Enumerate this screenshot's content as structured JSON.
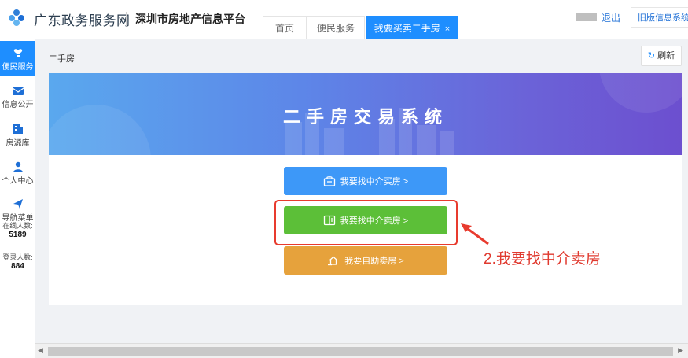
{
  "header": {
    "portal_name": "广东政务服务网",
    "platform_name": "深圳市房地产信息平台",
    "tabs": [
      {
        "label": "首页"
      },
      {
        "label": "便民服务"
      },
      {
        "label": "我要买卖二手房",
        "close": "×"
      }
    ],
    "logout": "退出",
    "old_version": "旧版信息系统"
  },
  "sidebar": {
    "items": [
      {
        "label": "便民服务",
        "icon": "heart-hand-icon"
      },
      {
        "label": "信息公开",
        "icon": "mail-icon"
      },
      {
        "label": "房源库",
        "icon": "building-icon"
      },
      {
        "label": "个人中心",
        "icon": "user-icon"
      },
      {
        "label": "导航菜单",
        "icon": "send-icon"
      }
    ],
    "online_label": "在线人数:",
    "online_count": "5189",
    "login_label": "登录人数:",
    "login_count": "884"
  },
  "breadcrumb": "二手房",
  "refresh_label": "刷新",
  "banner_title": "二手房交易系统",
  "buttons": {
    "buy_agent": "我要找中介买房 >",
    "sell_agent": "我要找中介卖房 >",
    "self_sell": "我要自助卖房 >"
  },
  "annotation": "2.我要找中介卖房",
  "colors": {
    "primary": "#1e8eff",
    "buy_button": "#3d98f8",
    "sell_button": "#5cbf38",
    "self_sell_button": "#e6a23c",
    "annotation": "#e03a2f"
  }
}
